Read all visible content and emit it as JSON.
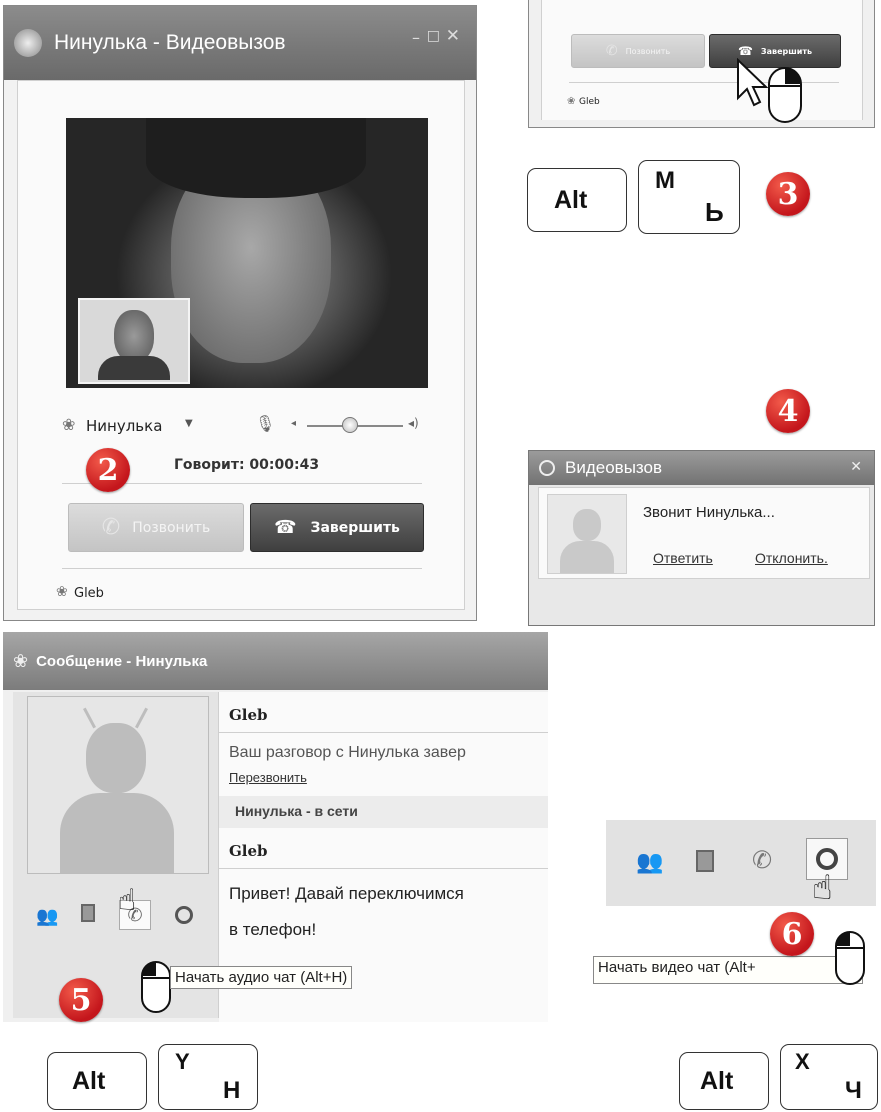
{
  "call_window": {
    "title": "Нинулька - Видеовызов",
    "contact_name": "Нинулька",
    "status": "Говорит: 00:00:43",
    "call_button": "Позвонить",
    "end_button": "Завершить",
    "footer_user": "Gleb",
    "step": "2"
  },
  "zoom_snippet": {
    "call_button": "Позвонить",
    "end_button": "Завершить",
    "footer_user": "Gleb"
  },
  "shortcut_end": {
    "modifier": "Alt",
    "key_latin": "M",
    "key_cyrillic": "Ь",
    "step": "3"
  },
  "incoming": {
    "step": "4",
    "title": "Видеовызов",
    "text": "Звонит Нинулька...",
    "answer": "Ответить",
    "decline": "Отклонить."
  },
  "message_window": {
    "title": "Сообщение - Нинулька",
    "messages": [
      {
        "author": "Gleb",
        "text": "Ваш разговор с Нинулька завер",
        "link": "Перезвонить"
      },
      {
        "status": "Нинулька - в сети"
      },
      {
        "author": "Gleb",
        "text1": "Привет! Давай переключимся",
        "text2": "в телефон!"
      }
    ],
    "tooltip": "Начать аудио чат (Alt+H)",
    "step": "5"
  },
  "video_panel": {
    "tooltip": "Начать видео чат (Alt+",
    "step": "6"
  },
  "shortcut_audio": {
    "modifier": "Alt",
    "key_latin": "Y",
    "key_cyrillic": "Н"
  },
  "shortcut_video": {
    "modifier": "Alt",
    "key_latin": "X",
    "key_cyrillic": "Ч"
  },
  "icons": [
    "contacts-icon",
    "history-icon",
    "phone-icon",
    "webcam-icon",
    "flower-status-icon",
    "microphone-icon",
    "speaker-icon",
    "hangup-icon",
    "hand-cursor-icon",
    "mouse-icon"
  ],
  "colors": {
    "badge": "#c4161c",
    "titlebar": "#5e5e5e",
    "dark_button": "#4a4a4a"
  }
}
